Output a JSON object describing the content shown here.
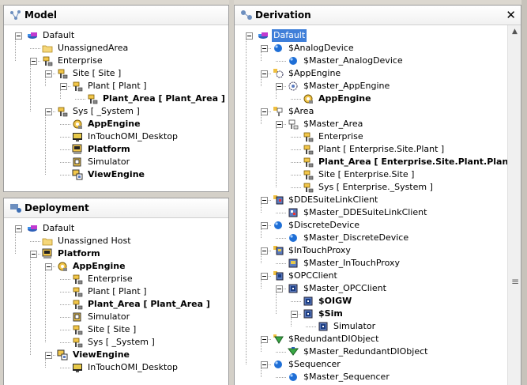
{
  "model": {
    "title": "Model",
    "rows": [
      {
        "label": "Dafault",
        "icon": "galaxy",
        "bold": false,
        "d": 1,
        "toggle": true
      },
      {
        "label": "UnassignedArea",
        "icon": "folder",
        "bold": false,
        "d": 2,
        "toggle": false
      },
      {
        "label": "Enterprise",
        "icon": "area",
        "bold": false,
        "d": 2,
        "toggle": true
      },
      {
        "label": "Site [ Site ]",
        "icon": "area",
        "bold": false,
        "d": 3,
        "toggle": true
      },
      {
        "label": "Plant [ Plant ]",
        "icon": "area",
        "bold": false,
        "d": 4,
        "toggle": true
      },
      {
        "label": "Plant_Area [ Plant_Area ]",
        "icon": "area",
        "bold": true,
        "d": 5,
        "toggle": false
      },
      {
        "label": "Sys [ _System ]",
        "icon": "area",
        "bold": false,
        "d": 3,
        "toggle": true
      },
      {
        "label": "AppEngine",
        "icon": "engine",
        "bold": true,
        "d": 4,
        "toggle": false
      },
      {
        "label": "InTouchOMI_Desktop",
        "icon": "intouch",
        "bold": false,
        "d": 4,
        "toggle": false
      },
      {
        "label": "Platform",
        "icon": "platform",
        "bold": true,
        "d": 4,
        "toggle": false
      },
      {
        "label": "Simulator",
        "icon": "object",
        "bold": false,
        "d": 4,
        "toggle": false
      },
      {
        "label": "ViewEngine",
        "icon": "viewengine",
        "bold": true,
        "d": 4,
        "toggle": false
      }
    ]
  },
  "deployment": {
    "title": "Deployment",
    "rows": [
      {
        "label": "Dafault",
        "icon": "galaxy",
        "bold": false,
        "d": 1,
        "toggle": true
      },
      {
        "label": "Unassigned Host",
        "icon": "folder",
        "bold": false,
        "d": 2,
        "toggle": false
      },
      {
        "label": "Platform",
        "icon": "platform",
        "bold": true,
        "d": 2,
        "toggle": true
      },
      {
        "label": "AppEngine",
        "icon": "engine",
        "bold": true,
        "d": 3,
        "toggle": true
      },
      {
        "label": "Enterprise",
        "icon": "area",
        "bold": false,
        "d": 4,
        "toggle": false
      },
      {
        "label": "Plant [ Plant ]",
        "icon": "area",
        "bold": false,
        "d": 4,
        "toggle": false
      },
      {
        "label": "Plant_Area [ Plant_Area ]",
        "icon": "area",
        "bold": true,
        "d": 4,
        "toggle": false
      },
      {
        "label": "Simulator",
        "icon": "object",
        "bold": false,
        "d": 4,
        "toggle": false
      },
      {
        "label": "Site [ Site ]",
        "icon": "area",
        "bold": false,
        "d": 4,
        "toggle": false
      },
      {
        "label": "Sys [ _System ]",
        "icon": "area",
        "bold": false,
        "d": 4,
        "toggle": false
      },
      {
        "label": "ViewEngine",
        "icon": "viewengine",
        "bold": true,
        "d": 3,
        "toggle": true
      },
      {
        "label": "InTouchOMI_Desktop",
        "icon": "intouch",
        "bold": false,
        "d": 4,
        "toggle": false
      }
    ]
  },
  "derivation": {
    "title": "Derivation",
    "close_label": "✕",
    "rows": [
      {
        "label": "Dafault",
        "icon": "galaxy",
        "bold": false,
        "d": 1,
        "toggle": true,
        "selected": true
      },
      {
        "label": "$AnalogDevice",
        "icon": "ball",
        "bold": false,
        "d": 2,
        "toggle": true
      },
      {
        "label": "$Master_AnalogDevice",
        "icon": "ball",
        "bold": false,
        "d": 3,
        "toggle": false
      },
      {
        "label": "$AppEngine",
        "icon": "template-engine",
        "bold": false,
        "d": 2,
        "toggle": true
      },
      {
        "label": "$Master_AppEngine",
        "icon": "engine-outline",
        "bold": false,
        "d": 3,
        "toggle": true
      },
      {
        "label": "AppEngine",
        "icon": "engine",
        "bold": true,
        "d": 4,
        "toggle": false
      },
      {
        "label": "$Area",
        "icon": "template-area",
        "bold": false,
        "d": 2,
        "toggle": true
      },
      {
        "label": "$Master_Area",
        "icon": "area-outline",
        "bold": false,
        "d": 3,
        "toggle": true
      },
      {
        "label": "Enterprise",
        "icon": "area",
        "bold": false,
        "d": 4,
        "toggle": false
      },
      {
        "label": "Plant [ Enterprise.Site.Plant ]",
        "icon": "area",
        "bold": false,
        "d": 4,
        "toggle": false
      },
      {
        "label": "Plant_Area [ Enterprise.Site.Plant.Plant_Area ]",
        "icon": "area",
        "bold": true,
        "d": 4,
        "toggle": false
      },
      {
        "label": "Site [ Enterprise.Site ]",
        "icon": "area",
        "bold": false,
        "d": 4,
        "toggle": false
      },
      {
        "label": "Sys [ Enterprise._System ]",
        "icon": "area",
        "bold": false,
        "d": 4,
        "toggle": false
      },
      {
        "label": "$DDESuiteLinkClient",
        "icon": "template-dde",
        "bold": false,
        "d": 2,
        "toggle": true
      },
      {
        "label": "$Master_DDESuiteLinkClient",
        "icon": "dde",
        "bold": false,
        "d": 3,
        "toggle": false
      },
      {
        "label": "$DiscreteDevice",
        "icon": "ball",
        "bold": false,
        "d": 2,
        "toggle": true
      },
      {
        "label": "$Master_DiscreteDevice",
        "icon": "ball",
        "bold": false,
        "d": 3,
        "toggle": false
      },
      {
        "label": "$InTouchProxy",
        "icon": "template-intouch",
        "bold": false,
        "d": 2,
        "toggle": true
      },
      {
        "label": "$Master_InTouchProxy",
        "icon": "intouchproxy",
        "bold": false,
        "d": 3,
        "toggle": false
      },
      {
        "label": "$OPCClient",
        "icon": "template-opc",
        "bold": false,
        "d": 2,
        "toggle": true
      },
      {
        "label": "$Master_OPCClient",
        "icon": "opc",
        "bold": false,
        "d": 3,
        "toggle": true
      },
      {
        "label": "$OIGW",
        "icon": "opc",
        "bold": true,
        "d": 4,
        "toggle": false
      },
      {
        "label": "$Sim",
        "icon": "opc",
        "bold": true,
        "d": 4,
        "toggle": true
      },
      {
        "label": "Simulator",
        "icon": "opc",
        "bold": false,
        "d": 5,
        "toggle": false
      },
      {
        "label": "$RedundantDIObject",
        "icon": "template-redundant",
        "bold": false,
        "d": 2,
        "toggle": true
      },
      {
        "label": "$Master_RedundantDIObject",
        "icon": "redundant",
        "bold": false,
        "d": 3,
        "toggle": false
      },
      {
        "label": "$Sequencer",
        "icon": "ball",
        "bold": false,
        "d": 2,
        "toggle": true
      },
      {
        "label": "$Master_Sequencer",
        "icon": "ball",
        "bold": false,
        "d": 3,
        "toggle": false
      }
    ]
  }
}
